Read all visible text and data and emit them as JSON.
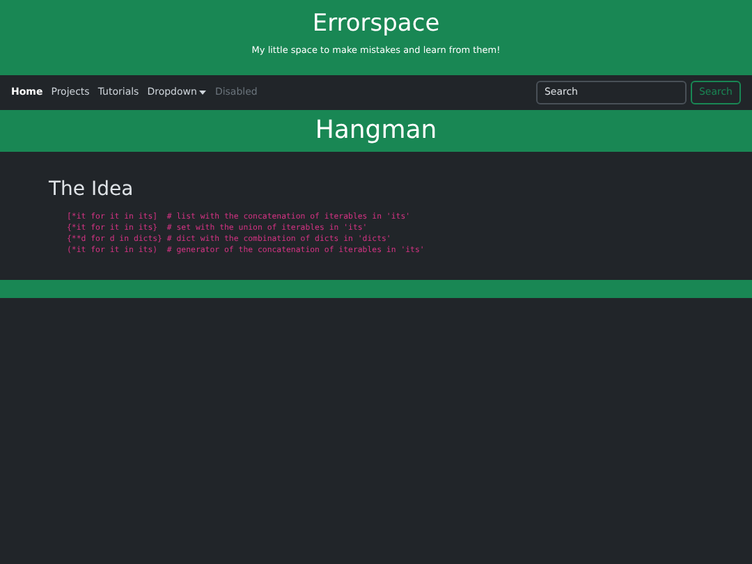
{
  "header": {
    "title": "Errorspace",
    "subtitle": "My little space to make mistakes and learn from them!"
  },
  "nav": {
    "items": [
      {
        "label": "Home",
        "kind": "link",
        "selected": true,
        "disabled": false
      },
      {
        "label": "Projects",
        "kind": "link",
        "selected": false,
        "disabled": false
      },
      {
        "label": "Tutorials",
        "kind": "link",
        "selected": false,
        "disabled": false
      },
      {
        "label": "Dropdown",
        "kind": "dropdown",
        "selected": false,
        "disabled": false
      },
      {
        "label": "Disabled",
        "kind": "link",
        "selected": false,
        "disabled": true
      }
    ],
    "search": {
      "placeholder": "Search",
      "button": "Search"
    }
  },
  "banner": {
    "title": "Hangman"
  },
  "section": {
    "heading": "The Idea",
    "code_lines": [
      "[*it for it in its]  # list with the concatenation of iterables in 'its'",
      "{*it for it in its}  # set with the union of iterables in 'its'",
      "{**d for d in dicts} # dict with the combination of dicts in 'dicts'",
      "(*it for it in its)  # generator of the concatenation of iterables in 'its'"
    ]
  }
}
